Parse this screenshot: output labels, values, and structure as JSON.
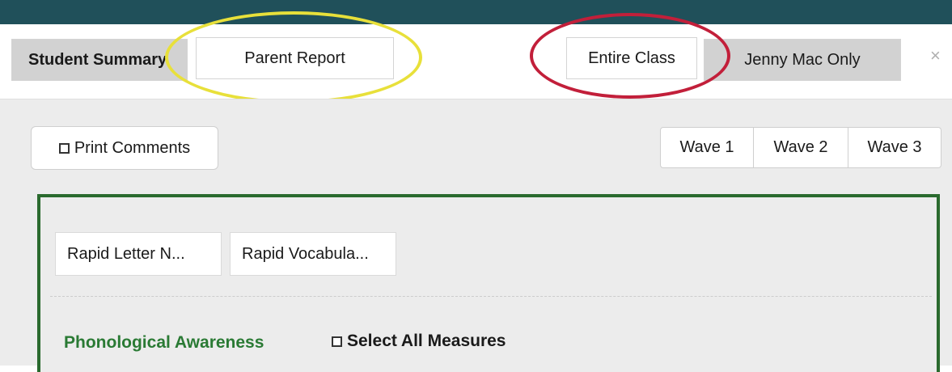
{
  "tabs": {
    "student_summary": "Student Summary",
    "parent_report": "Parent Report",
    "entire_class": "Entire Class",
    "jenny_only": "Jenny Mac Only",
    "close": "×"
  },
  "toolbar": {
    "print_comments": "Print Comments",
    "waves": [
      "Wave 1",
      "Wave 2",
      "Wave 3"
    ]
  },
  "measures": [
    "Rapid Letter N...",
    "Rapid Vocabula..."
  ],
  "section": {
    "title": "Phonological Awareness",
    "select_all": "Select All Measures"
  },
  "colors": {
    "top_bar": "#20505a",
    "highlight_yellow": "#e8e03a",
    "highlight_red": "#c21f3a",
    "section_green": "#2a7a34"
  }
}
